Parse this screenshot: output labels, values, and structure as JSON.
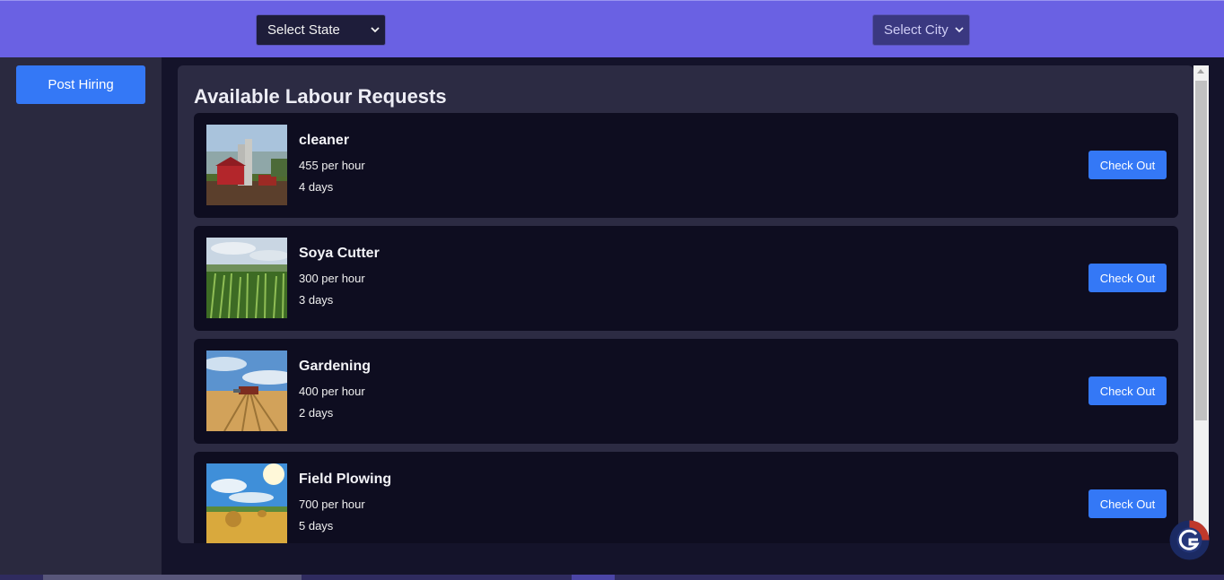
{
  "header": {
    "state_select": {
      "selected": "Select State"
    },
    "city_select": {
      "selected": "Select City"
    }
  },
  "sidebar": {
    "post_hiring_label": "Post Hiring"
  },
  "main": {
    "title": "Available Labour Requests",
    "requests": [
      {
        "title": "cleaner",
        "rate": "455 per hour",
        "duration": "4 days",
        "action": "Check Out",
        "image_icon": "farm-barn-image"
      },
      {
        "title": "Soya Cutter",
        "rate": "300 per hour",
        "duration": "3 days",
        "action": "Check Out",
        "image_icon": "corn-field-image"
      },
      {
        "title": "Gardening",
        "rate": "400 per hour",
        "duration": "2 days",
        "action": "Check Out",
        "image_icon": "wheat-harvest-image"
      },
      {
        "title": "Field Plowing",
        "rate": "700 per hour",
        "duration": "5 days",
        "action": "Check Out",
        "image_icon": "hay-bale-field-image"
      }
    ]
  },
  "colors": {
    "header_bg": "#6a61e3",
    "sidebar_bg": "#2a293f",
    "page_bg": "#14132a",
    "panel_bg": "#2c2b43",
    "card_bg": "#0e0d20",
    "button_blue": "#3478f6"
  }
}
